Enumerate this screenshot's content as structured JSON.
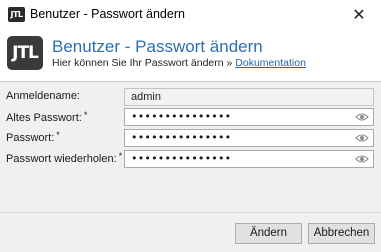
{
  "window": {
    "title": "Benutzer - Passwort ändern",
    "logo_text": "JTL",
    "close_glyph": "✕"
  },
  "header": {
    "logo_text": "JTL",
    "title": "Benutzer - Passwort ändern",
    "subtitle": "Hier können Sie Ihr Passwort ändern »",
    "link": "Dokumentation"
  },
  "form": {
    "username_label": "Anmeldename:",
    "username_value": "admin",
    "old_password_label": "Altes Passwort:",
    "old_password_value": "•••••••••••••••",
    "password_label": "Passwort:",
    "password_value": "•••••••••••••••",
    "repeat_label": "Passwort wiederholen:",
    "repeat_value": "•••••••••••••••",
    "required_marker": "*"
  },
  "buttons": {
    "change": "Ändern",
    "cancel": "Abbrechen"
  },
  "colors": {
    "accent_title": "#2d6eb2",
    "link": "#1a64b4",
    "panel_bg": "#f0f0f0"
  },
  "icons": {
    "reveal_password": "eye-icon"
  }
}
